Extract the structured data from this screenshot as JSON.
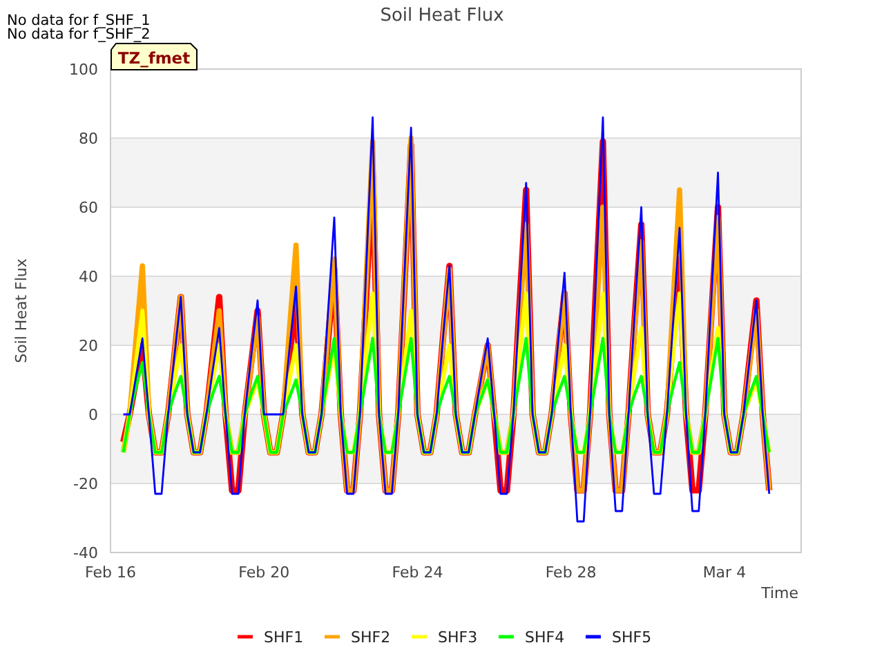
{
  "notes": [
    "No data for f_SHF_1",
    "No data for f_SHF_2"
  ],
  "timezone_badge": "TZ_fmet",
  "chart_data": {
    "type": "line",
    "title": "Soil Heat Flux",
    "xlabel": "Time",
    "ylabel": "Soil Heat Flux",
    "categories": [
      "Feb 16",
      null,
      null,
      null,
      null,
      null,
      null,
      null,
      null,
      null,
      null,
      null,
      null,
      null,
      null,
      null,
      null,
      null,
      null,
      null,
      null,
      null,
      null,
      null,
      "Feb 20",
      null,
      null,
      null,
      null,
      null,
      null,
      null,
      null,
      null,
      null,
      null,
      null,
      null,
      null,
      null,
      null,
      null,
      null,
      null,
      null,
      null,
      null,
      null,
      "Feb 24",
      null,
      null,
      null,
      null,
      null,
      null,
      null,
      null,
      null,
      null,
      null,
      null,
      null,
      null,
      null,
      null,
      null,
      null,
      null,
      null,
      null,
      null,
      null,
      "Feb 28",
      null,
      null,
      null,
      null,
      null,
      null,
      null,
      null,
      null,
      null,
      null,
      null,
      null,
      null,
      null,
      null,
      null,
      null,
      null,
      null,
      null,
      null,
      null,
      "Mar 4",
      null,
      null,
      null,
      null,
      null,
      null,
      null,
      null,
      null,
      null,
      null
    ],
    "ylim": [
      -40,
      100
    ],
    "grid": true,
    "legend": "bottom",
    "yticks": [
      -40,
      -20,
      0,
      20,
      40,
      60,
      80,
      100
    ],
    "series": [
      {
        "name": "SHF1",
        "color": "#ff0000",
        "values": [
          null,
          null,
          -8,
          0,
          10,
          20,
          0,
          -11,
          -11,
          0,
          17,
          34,
          0,
          -11,
          -11,
          0,
          17,
          34,
          0,
          -22,
          -22,
          0,
          15,
          30,
          0,
          -11,
          -11,
          0,
          17,
          33,
          0,
          -11,
          -11,
          0,
          21,
          42,
          0,
          -22,
          -22,
          0,
          35,
          70,
          0,
          -22,
          -22,
          0,
          39,
          78,
          0,
          -11,
          -11,
          0,
          22,
          43,
          0,
          -11,
          -11,
          0,
          10,
          20,
          0,
          -22,
          -22,
          0,
          33,
          65,
          0,
          -11,
          -11,
          0,
          18,
          35,
          0,
          -22,
          -22,
          0,
          40,
          79,
          0,
          -22,
          -22,
          0,
          28,
          55,
          0,
          -11,
          -11,
          0,
          23,
          45,
          0,
          -22,
          -22,
          0,
          30,
          60,
          0,
          -11,
          -11,
          0,
          17,
          33,
          0,
          -22,
          null,
          null,
          null,
          null
        ]
      },
      {
        "name": "SHF2",
        "color": "#ffa500",
        "values": [
          null,
          null,
          -11,
          0,
          22,
          43,
          0,
          -11,
          -11,
          0,
          17,
          34,
          0,
          -11,
          -11,
          0,
          15,
          30,
          0,
          -11,
          -11,
          0,
          14,
          28,
          0,
          -11,
          -11,
          0,
          25,
          49,
          0,
          -11,
          -11,
          0,
          23,
          45,
          0,
          -22,
          -22,
          0,
          40,
          79,
          0,
          -22,
          -22,
          0,
          40,
          80,
          0,
          -11,
          -11,
          0,
          21,
          42,
          0,
          -11,
          -11,
          0,
          10,
          20,
          0,
          -11,
          -11,
          0,
          28,
          55,
          0,
          -11,
          -11,
          0,
          18,
          35,
          0,
          -22,
          -22,
          0,
          30,
          60,
          0,
          -22,
          -22,
          0,
          25,
          50,
          0,
          -11,
          -11,
          0,
          33,
          65,
          0,
          -11,
          -11,
          0,
          29,
          57,
          0,
          -11,
          -11,
          0,
          15,
          30,
          0,
          -22,
          null,
          null,
          null,
          null
        ]
      },
      {
        "name": "SHF3",
        "color": "#ffff00",
        "values": [
          null,
          null,
          -11,
          0,
          15,
          30,
          0,
          -11,
          -11,
          0,
          10,
          20,
          0,
          -11,
          -11,
          0,
          10,
          20,
          0,
          -11,
          -11,
          0,
          5,
          10,
          0,
          -11,
          -11,
          0,
          10,
          20,
          0,
          -11,
          -11,
          0,
          10,
          20,
          0,
          -11,
          -11,
          0,
          18,
          35,
          0,
          -11,
          -11,
          0,
          15,
          30,
          0,
          -11,
          -11,
          0,
          10,
          20,
          0,
          -11,
          -11,
          0,
          5,
          10,
          0,
          -11,
          -11,
          0,
          18,
          35,
          0,
          -11,
          -11,
          0,
          10,
          20,
          0,
          -11,
          -11,
          0,
          18,
          35,
          0,
          -11,
          -11,
          0,
          13,
          25,
          0,
          -11,
          -11,
          0,
          18,
          35,
          0,
          -11,
          -11,
          0,
          13,
          25,
          0,
          -11,
          -11,
          0,
          5,
          10,
          0,
          -11,
          null,
          null,
          null,
          null
        ]
      },
      {
        "name": "SHF4",
        "color": "#00ff00",
        "values": [
          null,
          null,
          -11,
          0,
          8,
          15,
          0,
          -11,
          -11,
          0,
          6,
          11,
          0,
          -11,
          -11,
          0,
          6,
          11,
          0,
          -11,
          -11,
          0,
          6,
          11,
          0,
          -11,
          -11,
          0,
          5,
          10,
          0,
          -11,
          -11,
          0,
          11,
          22,
          0,
          -11,
          -11,
          0,
          11,
          22,
          0,
          -11,
          -11,
          0,
          11,
          22,
          0,
          -11,
          -11,
          0,
          6,
          11,
          0,
          -11,
          -11,
          0,
          5,
          10,
          0,
          -11,
          -11,
          0,
          11,
          22,
          0,
          -11,
          -11,
          0,
          6,
          11,
          0,
          -11,
          -11,
          0,
          11,
          22,
          0,
          -11,
          -11,
          0,
          6,
          11,
          0,
          -11,
          -11,
          0,
          8,
          15,
          0,
          -11,
          -11,
          0,
          11,
          22,
          0,
          -11,
          -11,
          0,
          6,
          11,
          0,
          -11,
          null,
          null,
          null,
          null
        ]
      },
      {
        "name": "SHF5",
        "color": "#0000ff",
        "values": [
          null,
          null,
          0,
          0,
          11,
          22,
          0,
          -23,
          -23,
          0,
          17,
          34,
          0,
          -11,
          -11,
          0,
          13,
          25,
          0,
          -23,
          -23,
          0,
          17,
          33,
          0,
          0,
          0,
          0,
          19,
          37,
          0,
          -11,
          -11,
          0,
          29,
          57,
          0,
          -23,
          -23,
          0,
          43,
          86,
          0,
          -23,
          -23,
          0,
          42,
          83,
          0,
          -11,
          -11,
          0,
          22,
          43,
          0,
          -11,
          -11,
          0,
          11,
          22,
          0,
          -23,
          -23,
          0,
          34,
          67,
          0,
          -11,
          -11,
          0,
          21,
          41,
          0,
          -31,
          -31,
          0,
          43,
          86,
          0,
          -28,
          -28,
          0,
          30,
          60,
          0,
          -23,
          -23,
          0,
          27,
          54,
          0,
          -28,
          -28,
          0,
          35,
          70,
          0,
          -11,
          -11,
          0,
          17,
          33,
          0,
          -23,
          null,
          null,
          null,
          null
        ]
      }
    ]
  }
}
